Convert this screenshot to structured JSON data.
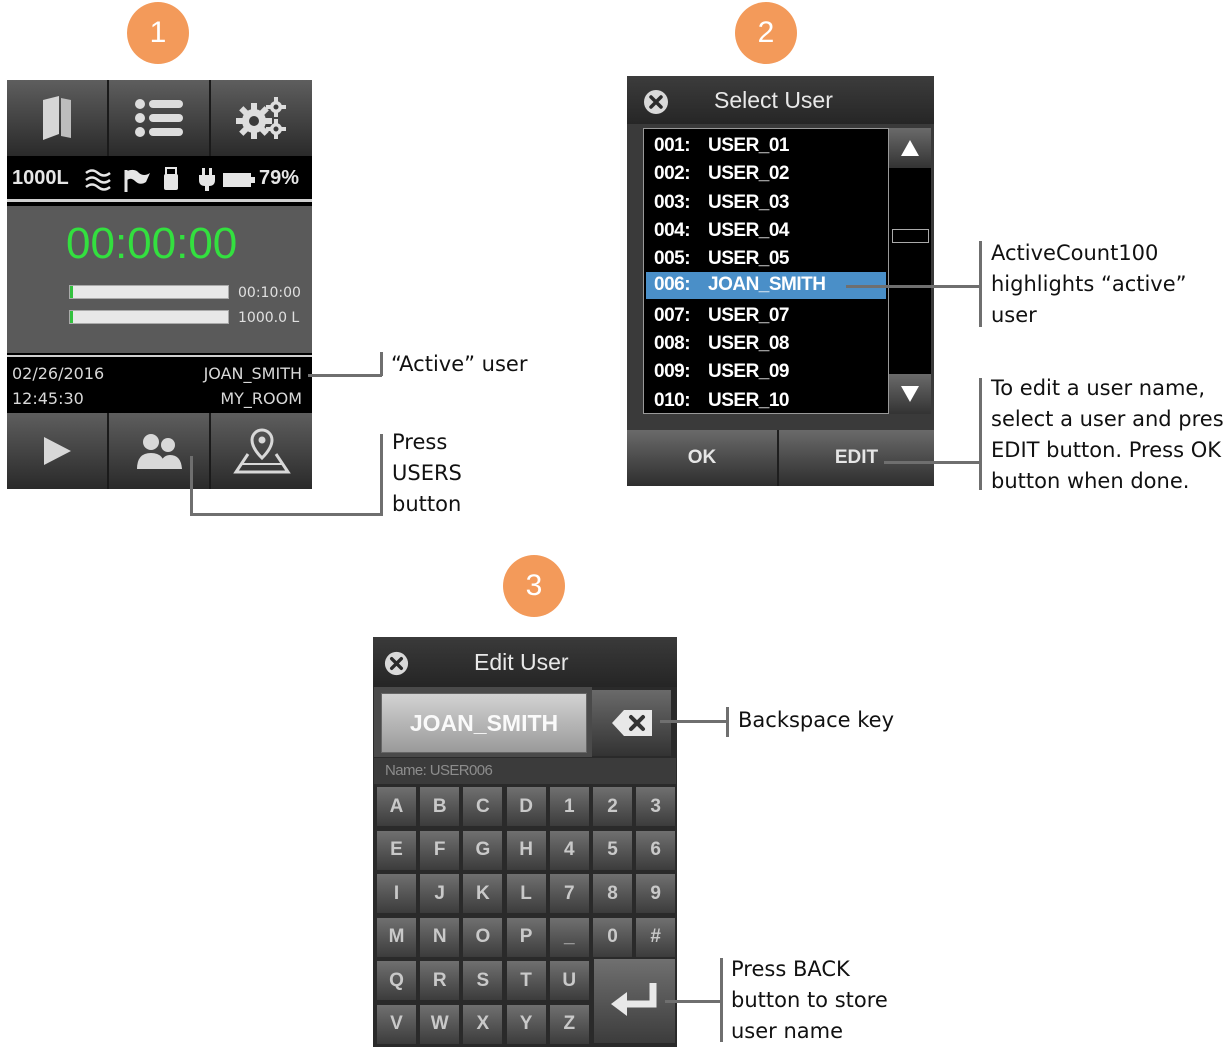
{
  "steps": {
    "s1": "1",
    "s2": "2",
    "s3": "3"
  },
  "screen1": {
    "toolbar_icons": [
      "book-icon",
      "list-icon",
      "gears-icon"
    ],
    "status": {
      "volume": "1000L",
      "battery": "79%"
    },
    "timer": "00:00:00",
    "progress": [
      {
        "label": "00:10:00",
        "fill": 0.02
      },
      {
        "label": "1000.0 L",
        "fill": 0.02
      }
    ],
    "date": "02/26/2016",
    "time": "12:45:30",
    "user": "JOAN_SMITH",
    "location": "MY_ROOM",
    "bottom_icons": [
      "play-icon",
      "users-icon",
      "location-map-icon"
    ]
  },
  "screen2": {
    "title": "Select User",
    "users": [
      {
        "num": "001:",
        "name": "USER_01"
      },
      {
        "num": "002:",
        "name": "USER_02"
      },
      {
        "num": "003:",
        "name": "USER_03"
      },
      {
        "num": "004:",
        "name": "USER_04"
      },
      {
        "num": "005:",
        "name": "USER_05"
      },
      {
        "num": "006:",
        "name": "JOAN_SMITH"
      },
      {
        "num": "007:",
        "name": "USER_07"
      },
      {
        "num": "008:",
        "name": "USER_08"
      },
      {
        "num": "009:",
        "name": "USER_09"
      },
      {
        "num": "010:",
        "name": "USER_10"
      }
    ],
    "selected_index": 5,
    "ok_label": "OK",
    "edit_label": "EDIT"
  },
  "screen3": {
    "title": "Edit User",
    "input_value": "JOAN_SMITH",
    "name_hint": "Name: USER006",
    "keys": [
      [
        "A",
        "B",
        "C",
        "D",
        "1",
        "2",
        "3"
      ],
      [
        "E",
        "F",
        "G",
        "H",
        "4",
        "5",
        "6"
      ],
      [
        "I",
        "J",
        "K",
        "L",
        "7",
        "8",
        "9"
      ],
      [
        "M",
        "N",
        "O",
        "P",
        "_",
        "0",
        "#"
      ],
      [
        "Q",
        "R",
        "S",
        "T",
        "U"
      ],
      [
        "V",
        "W",
        "X",
        "Y",
        "Z"
      ]
    ]
  },
  "annotations": {
    "active_user": "“Active” user",
    "press_users": [
      "Press",
      "USERS",
      "button"
    ],
    "highlight": [
      "ActiveCount100",
      "highlights “active”",
      "user"
    ],
    "edit_help": [
      "To edit a user name,",
      "select a user and press",
      "EDIT button. Press OK",
      "button when done."
    ],
    "backspace": "Backspace key",
    "back_help": [
      "Press BACK",
      "button to store",
      "user name"
    ]
  },
  "colors": {
    "accent_orange": "#f39a5a",
    "timer_green": "#33e03f",
    "selection_blue": "#4a8fc8"
  }
}
